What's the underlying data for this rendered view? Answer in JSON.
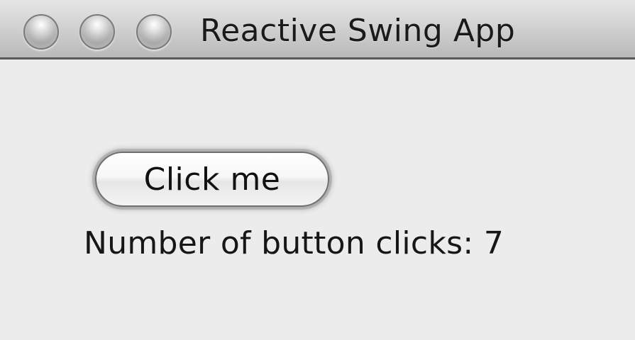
{
  "window": {
    "title": "Reactive Swing App",
    "controls": [
      {
        "name": "close-button",
        "icon": "traffic-light-close-icon"
      },
      {
        "name": "minimize-button",
        "icon": "traffic-light-minimize-icon"
      },
      {
        "name": "zoom-button",
        "icon": "traffic-light-zoom-icon"
      }
    ]
  },
  "main": {
    "button_label": "Click me",
    "click_count_label": "Number of button clicks:",
    "click_count_value": "7"
  },
  "colors": {
    "window_background": "#ececec",
    "titlebar_top": "#e6e6e6",
    "titlebar_bottom": "#b9b9b9",
    "text": "#111111"
  }
}
